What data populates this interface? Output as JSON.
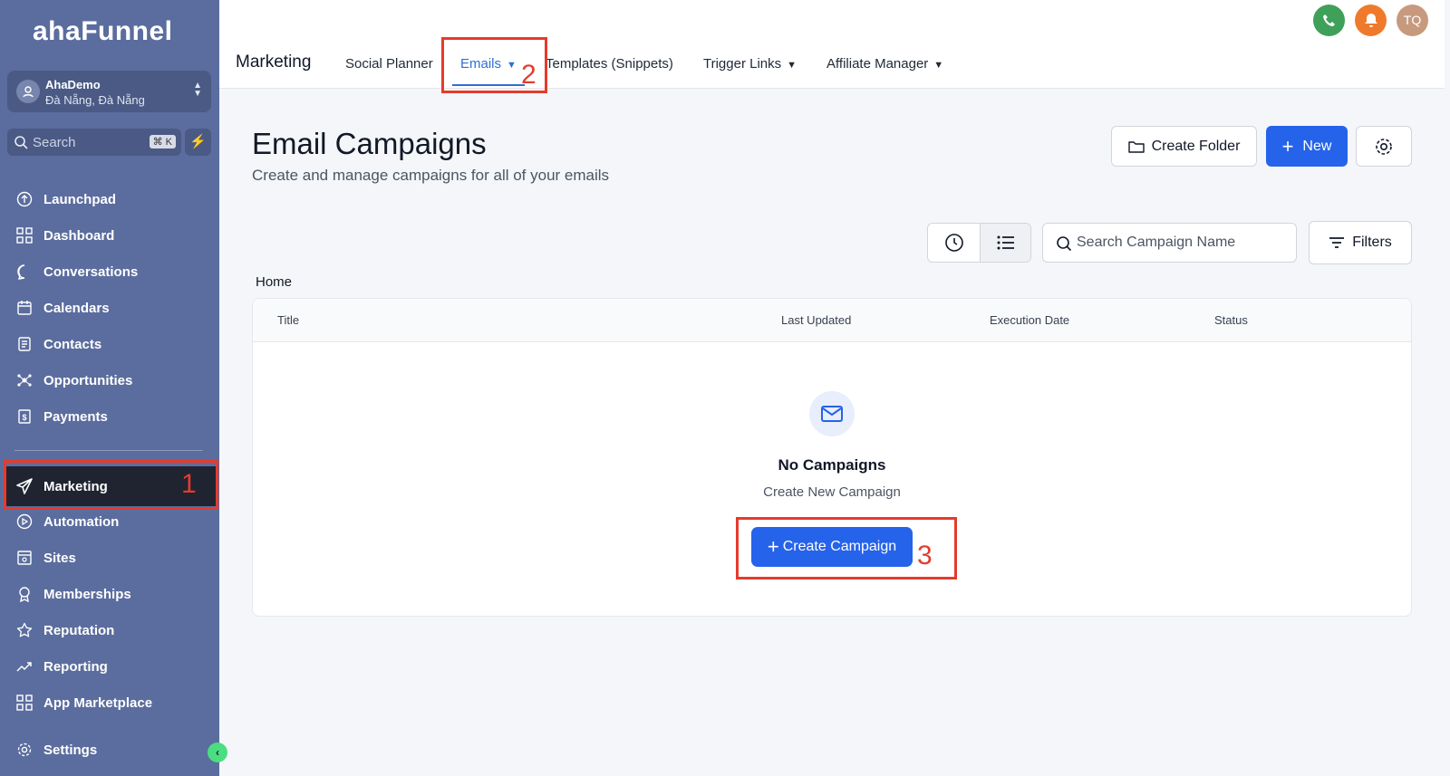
{
  "brand": {
    "logo_text": "ahaFunnel"
  },
  "account": {
    "name": "AhaDemo",
    "location": "Đà Nẵng, Đà Nẵng"
  },
  "sidebar_search": {
    "placeholder": "Search",
    "shortcut": "⌘ K"
  },
  "sidebar": {
    "items": [
      {
        "label": "Launchpad",
        "icon": "rocket-icon"
      },
      {
        "label": "Dashboard",
        "icon": "grid-icon"
      },
      {
        "label": "Conversations",
        "icon": "chat-icon"
      },
      {
        "label": "Calendars",
        "icon": "calendar-icon"
      },
      {
        "label": "Contacts",
        "icon": "contacts-icon"
      },
      {
        "label": "Opportunities",
        "icon": "opportunities-icon"
      },
      {
        "label": "Payments",
        "icon": "payments-icon"
      },
      {
        "label": "Marketing",
        "icon": "send-icon",
        "active": true
      },
      {
        "label": "Automation",
        "icon": "automation-icon"
      },
      {
        "label": "Sites",
        "icon": "sites-icon"
      },
      {
        "label": "Memberships",
        "icon": "badge-icon"
      },
      {
        "label": "Reputation",
        "icon": "star-icon"
      },
      {
        "label": "Reporting",
        "icon": "trend-icon"
      },
      {
        "label": "App Marketplace",
        "icon": "apps-icon"
      },
      {
        "label": "Settings",
        "icon": "gear-icon"
      }
    ]
  },
  "annotations": {
    "one": "1",
    "two": "2",
    "three": "3"
  },
  "topbar": {
    "section": "Marketing",
    "tabs": [
      {
        "label": "Social Planner"
      },
      {
        "label": "Emails",
        "active": true
      },
      {
        "label": "Templates (Snippets)"
      },
      {
        "label": "Trigger Links"
      },
      {
        "label": "Affiliate Manager"
      }
    ],
    "user_initials": "TQ",
    "colors": {
      "phone": "#3fa05a",
      "bell": "#f07a2b",
      "avatar": "#c79a7e"
    }
  },
  "page": {
    "title": "Email Campaigns",
    "subtitle": "Create and manage campaigns for all of your emails",
    "create_folder": "Create Folder",
    "new": "New",
    "search_placeholder": "Search Campaign Name",
    "filters": "Filters",
    "breadcrumb": "Home"
  },
  "table": {
    "columns": [
      "Title",
      "Last Updated",
      "Execution Date",
      "Status"
    ],
    "empty_title": "No Campaigns",
    "empty_sub": "Create New Campaign",
    "create_button": "Create Campaign"
  },
  "colors": {
    "sidebar": "#5b6d9e",
    "primary": "#2563eb",
    "annotation": "#e53b2c"
  }
}
